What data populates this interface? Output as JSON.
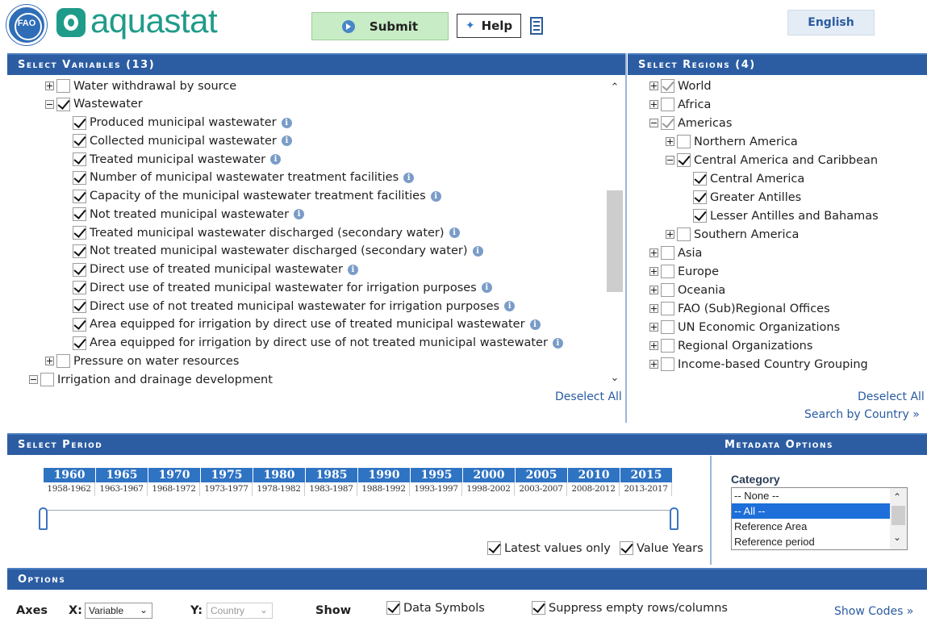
{
  "header": {
    "app_name": "aquastat",
    "submit_label": "Submit",
    "help_label": "Help",
    "language_label": "English"
  },
  "variables": {
    "title": "Select Variables (13)",
    "items": [
      {
        "label": "Water withdrawal by source",
        "indent": 1,
        "expander": "plus",
        "check": "off",
        "info": false
      },
      {
        "label": "Wastewater",
        "indent": 1,
        "expander": "minus",
        "check": "on",
        "info": false
      },
      {
        "label": "Produced municipal wastewater",
        "indent": 2,
        "expander": "none",
        "check": "on",
        "info": true
      },
      {
        "label": "Collected municipal wastewater",
        "indent": 2,
        "expander": "none",
        "check": "on",
        "info": true
      },
      {
        "label": "Treated municipal wastewater",
        "indent": 2,
        "expander": "none",
        "check": "on",
        "info": true
      },
      {
        "label": "Number of municipal wastewater treatment facilities",
        "indent": 2,
        "expander": "none",
        "check": "on",
        "info": true
      },
      {
        "label": "Capacity of the municipal wastewater treatment facilities",
        "indent": 2,
        "expander": "none",
        "check": "on",
        "info": true
      },
      {
        "label": "Not treated municipal wastewater",
        "indent": 2,
        "expander": "none",
        "check": "on",
        "info": true
      },
      {
        "label": "Treated municipal wastewater discharged (secondary water)",
        "indent": 2,
        "expander": "none",
        "check": "on",
        "info": true
      },
      {
        "label": "Not treated municipal wastewater discharged (secondary water)",
        "indent": 2,
        "expander": "none",
        "check": "on",
        "info": true
      },
      {
        "label": "Direct use of treated municipal wastewater",
        "indent": 2,
        "expander": "none",
        "check": "on",
        "info": true
      },
      {
        "label": "Direct use of treated municipal wastewater for irrigation purposes",
        "indent": 2,
        "expander": "none",
        "check": "on",
        "info": true
      },
      {
        "label": "Direct use of not treated municipal wastewater for irrigation purposes",
        "indent": 2,
        "expander": "none",
        "check": "on",
        "info": true
      },
      {
        "label": "Area equipped for irrigation by direct use of treated municipal wastewater",
        "indent": 2,
        "expander": "none",
        "check": "on",
        "info": true
      },
      {
        "label": "Area equipped for irrigation by direct use of not treated municipal wastewater",
        "indent": 2,
        "expander": "none",
        "check": "on",
        "info": true
      },
      {
        "label": "Pressure on water resources",
        "indent": 1,
        "expander": "plus",
        "check": "off",
        "info": false
      },
      {
        "label": "Irrigation and drainage development",
        "indent": 0,
        "expander": "minus",
        "check": "off",
        "info": false
      }
    ],
    "deselect_label": "Deselect All"
  },
  "regions": {
    "title": "Select Regions (4)",
    "items": [
      {
        "label": "World",
        "indent": 0,
        "expander": "plus",
        "check": "partial"
      },
      {
        "label": "Africa",
        "indent": 0,
        "expander": "plus",
        "check": "off"
      },
      {
        "label": "Americas",
        "indent": 0,
        "expander": "minus",
        "check": "partial"
      },
      {
        "label": "Northern America",
        "indent": 1,
        "expander": "plus",
        "check": "off"
      },
      {
        "label": "Central America and Caribbean",
        "indent": 1,
        "expander": "minus",
        "check": "on"
      },
      {
        "label": "Central America",
        "indent": 2,
        "expander": "none",
        "check": "on"
      },
      {
        "label": "Greater Antilles",
        "indent": 2,
        "expander": "none",
        "check": "on"
      },
      {
        "label": "Lesser Antilles and Bahamas",
        "indent": 2,
        "expander": "none",
        "check": "on"
      },
      {
        "label": "Southern America",
        "indent": 1,
        "expander": "plus",
        "check": "off"
      },
      {
        "label": "Asia",
        "indent": 0,
        "expander": "plus",
        "check": "off"
      },
      {
        "label": "Europe",
        "indent": 0,
        "expander": "plus",
        "check": "off"
      },
      {
        "label": "Oceania",
        "indent": 0,
        "expander": "plus",
        "check": "off"
      },
      {
        "label": "FAO (Sub)Regional Offices",
        "indent": 0,
        "expander": "plus",
        "check": "off"
      },
      {
        "label": "UN Economic Organizations",
        "indent": 0,
        "expander": "plus",
        "check": "off"
      },
      {
        "label": "Regional Organizations",
        "indent": 0,
        "expander": "plus",
        "check": "off"
      },
      {
        "label": "Income-based Country Grouping",
        "indent": 0,
        "expander": "plus",
        "check": "off"
      }
    ],
    "deselect_label": "Deselect All",
    "search_label": "Search by Country »"
  },
  "period": {
    "title": "Select Period",
    "years": [
      "1960",
      "1965",
      "1970",
      "1975",
      "1980",
      "1985",
      "1990",
      "1995",
      "2000",
      "2005",
      "2010",
      "2015"
    ],
    "ranges": [
      "1958-1962",
      "1963-1967",
      "1968-1972",
      "1973-1977",
      "1978-1982",
      "1983-1987",
      "1988-1992",
      "1993-1997",
      "1998-2002",
      "2003-2007",
      "2008-2012",
      "2013-2017"
    ],
    "latest_label": "Latest values only",
    "latest_checked": true,
    "value_years_label": "Value Years",
    "value_years_checked": true
  },
  "metadata": {
    "title": "Metadata Options",
    "category_label": "Category",
    "options": [
      "-- None --",
      "-- All --",
      "Reference Area",
      "Reference period"
    ],
    "selected_index": 1
  },
  "options": {
    "title": "Options",
    "axes_label": "Axes",
    "x_label": "X:",
    "x_value": "Variable",
    "y_label": "Y:",
    "y_value": "Country",
    "show_label": "Show",
    "data_symbols_label": "Data Symbols",
    "data_symbols_checked": true,
    "suppress_label": "Suppress empty rows/columns",
    "suppress_checked": true,
    "show_codes_label": "Show Codes »"
  },
  "colors": {
    "header_blue": "#2c5da3",
    "brand_teal": "#1f9b8a",
    "link_blue": "#2a5ba0",
    "submit_green": "#c8ecc5",
    "period_blue": "#2f73c3"
  }
}
